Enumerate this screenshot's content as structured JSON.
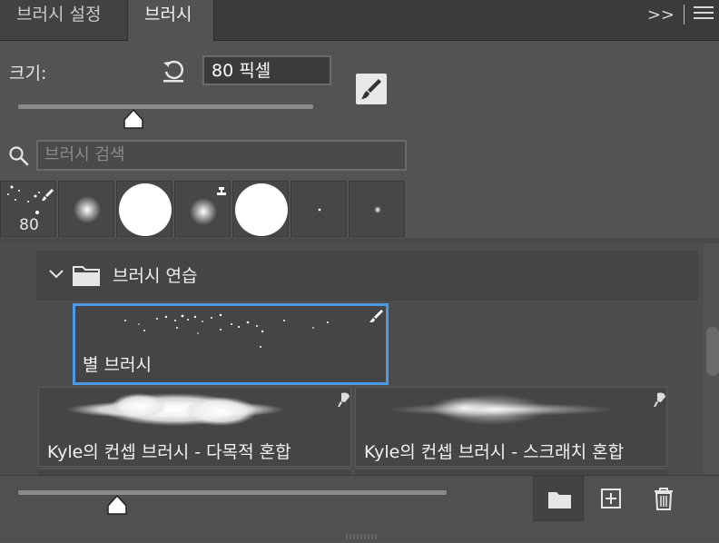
{
  "tabs": [
    {
      "label": "브러시 설정",
      "active": false
    },
    {
      "label": "브러시",
      "active": true
    }
  ],
  "tab_tools": {
    "expand_icon": "double-chevron-right-icon",
    "menu_icon": "hamburger-menu-icon",
    "expand_label": ">>"
  },
  "size": {
    "label": "크기:",
    "value": "80 픽셀",
    "slider_fraction": 0.39
  },
  "search": {
    "placeholder": "브러시 검색",
    "value": ""
  },
  "presets": [
    {
      "num": "80",
      "kind": "spatter"
    },
    {
      "num": "",
      "kind": "soft-round"
    },
    {
      "num": "",
      "kind": "hard-round"
    },
    {
      "num": "",
      "kind": "soft-round-stamp"
    },
    {
      "num": "",
      "kind": "hard-round"
    },
    {
      "num": "",
      "kind": "tiny-dot"
    },
    {
      "num": "",
      "kind": "small-soft-dot"
    }
  ],
  "group": {
    "name": "브러시 연습",
    "expanded": true
  },
  "brushes": [
    {
      "name": "별 브러시",
      "selected": true,
      "icon": "brush-icon"
    },
    {
      "name": "Kyle의 컨셉 브러시 - 다목적 혼합",
      "selected": false,
      "icon": "mixer-brush-icon"
    },
    {
      "name": "Kyle의 컨셉 브러시 - 스크래치 혼합",
      "selected": false,
      "icon": "mixer-brush-icon"
    }
  ],
  "bottom": {
    "preview_slider_fraction": 0.23
  },
  "colors": {
    "panel": "#535353",
    "accent": "#4d9be6",
    "tabbar": "#3b3b3b"
  }
}
